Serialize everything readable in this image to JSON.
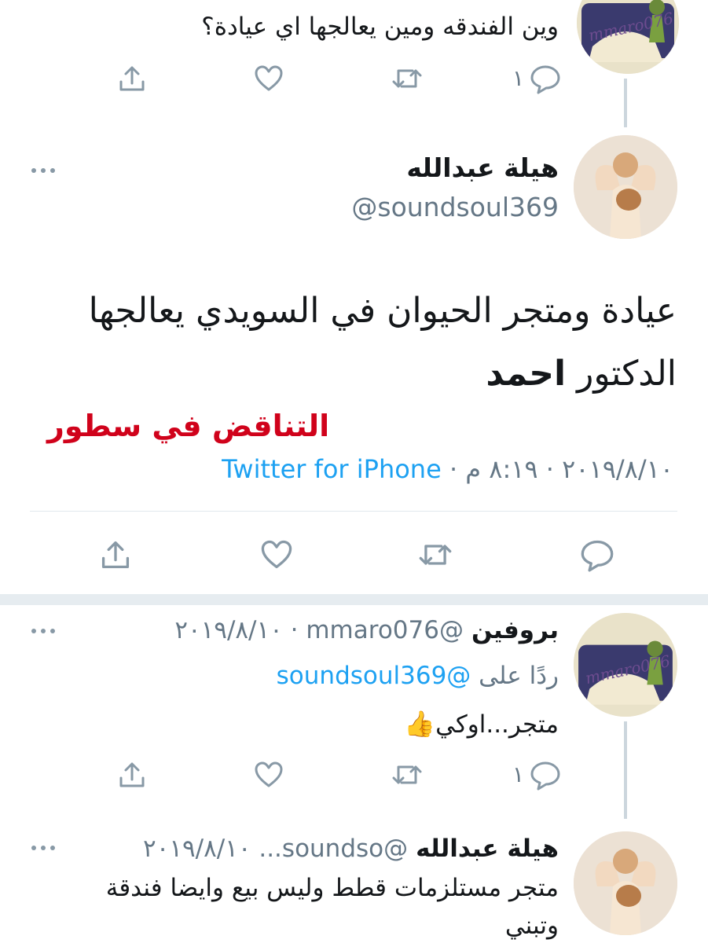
{
  "top_tweet": {
    "text": "وين الفندقه ومين يعالجها اي عيادة؟",
    "reply_count": "١",
    "avatar_caption": "mmaro076"
  },
  "main_tweet": {
    "display_name": "هيلة عبدالله",
    "handle": "@soundsoul369",
    "body_line1": "عيادة ومتجر الحيوان في السويدي  يعالجها",
    "body_line2_normal": "الدكتور ",
    "body_line2_bold": "احمد",
    "annotation": "التناقض في سطور",
    "date_time": "٢٠١٩/٨/١٠ · ٨:١٩ م · ",
    "source": "Twitter for iPhone"
  },
  "reply1": {
    "display_name": "بروفين",
    "handle_date": "@mmaro076 · ٢٠١٩/٨/١٠",
    "reply_prefix": "ردًا على ",
    "reply_to": "@soundsoul369",
    "text": "متجر...اوكي",
    "emoji": "👍",
    "reply_count": "١",
    "avatar_caption": "mmaro076"
  },
  "reply2": {
    "display_name": "هيلة عبدالله",
    "handle_date": "@soundso... ٢٠١٩/٨/١٠",
    "text_line1": "متجر مستلزمات قطط وليس بيع وايضا فندقة",
    "text_line2": "وتبني"
  },
  "colors": {
    "accent": "#1da1f2",
    "annotation_red": "#d0021b",
    "gray": "#657786"
  }
}
